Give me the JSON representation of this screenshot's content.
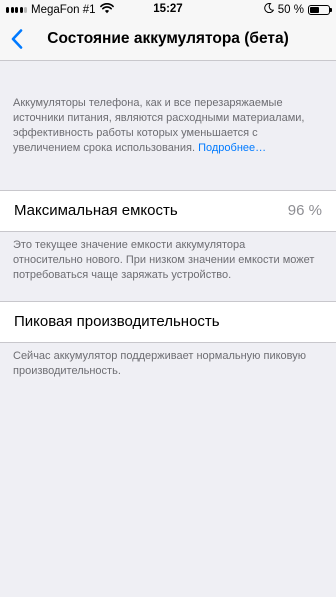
{
  "status_bar": {
    "carrier": "MegaFon #1",
    "time": "15:27",
    "battery_percent": "50 %",
    "battery_level": 0.5,
    "signal_bars_filled": 4,
    "signal_bars_total": 5,
    "icons": [
      "signal-icon",
      "wifi-icon",
      "moon-icon",
      "battery-icon"
    ]
  },
  "nav": {
    "back_icon": "chevron-left-icon",
    "title": "Состояние аккумулятора (бета)"
  },
  "intro": {
    "text": "Аккумуляторы телефона, как и все перезаряжаемые источники питания, являются расходными материалами, эффективность работы которых уменьшается с увеличением срока использования.",
    "link": "Подробнее…"
  },
  "max_capacity": {
    "label": "Максимальная емкость",
    "value": "96 %",
    "footer": "Это текущее значение емкости аккумулятора относительно нового. При низком значении емкости может потребоваться чаще заряжать устройство."
  },
  "peak_performance": {
    "label": "Пиковая производительность",
    "footer": "Сейчас аккумулятор поддерживает нормальную пиковую производительность."
  },
  "colors": {
    "accent": "#007aff",
    "background": "#efeff4",
    "footer_text": "#6d6d72",
    "value_text": "#8e8e93"
  }
}
